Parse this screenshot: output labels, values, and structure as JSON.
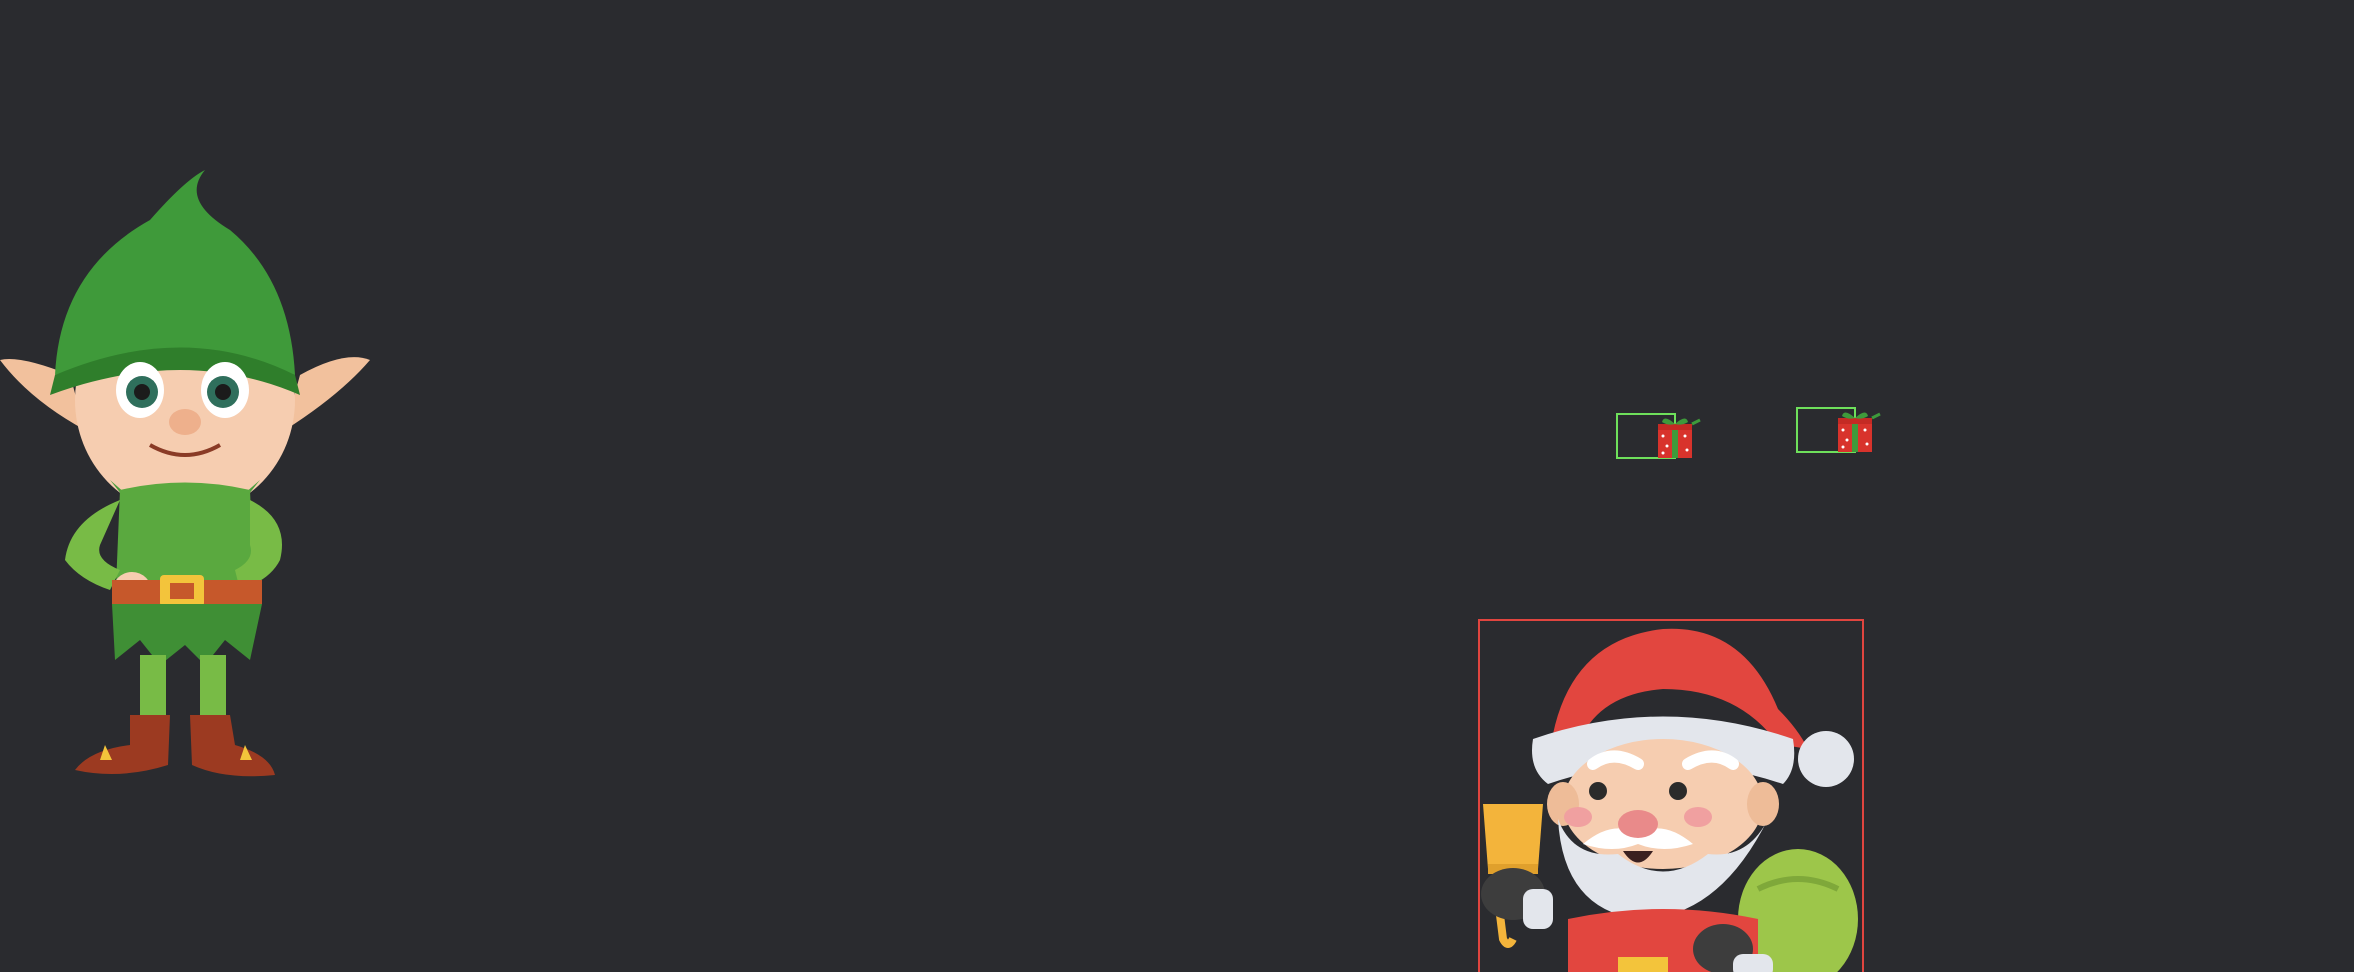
{
  "scene": {
    "background_color": "#2a2b2f",
    "sprites": {
      "elf": {
        "icon": "elf-character-icon"
      },
      "gifts": [
        {
          "icon": "gift-box-icon",
          "hitbox_color": "#6ee05b"
        },
        {
          "icon": "gift-box-icon",
          "hitbox_color": "#6ee05b"
        }
      ],
      "santa": {
        "icon": "santa-character-icon",
        "hitbox_color": "#e0453f"
      }
    }
  }
}
